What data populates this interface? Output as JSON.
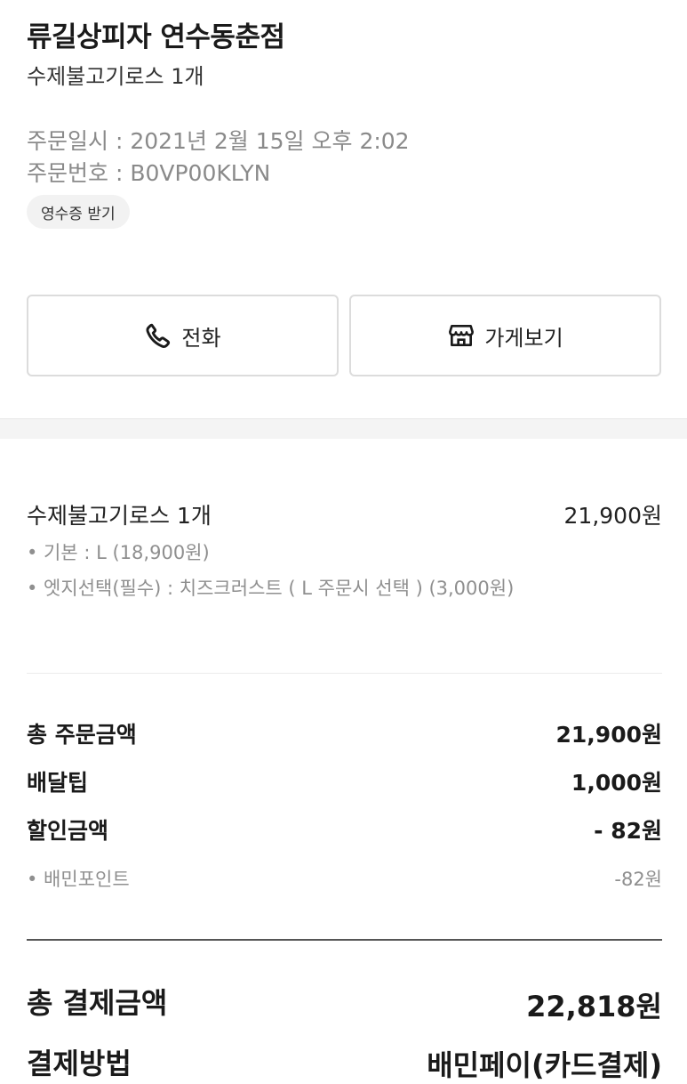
{
  "header": {
    "store_name": "류길상피자 연수동춘점",
    "order_summary": "수제불고기로스 1개",
    "order_date": "주문일시 : 2021년 2월 15일 오후 2:02",
    "order_number": "주문번호 : B0VP00KLYN",
    "receipt_label": "영수증 받기"
  },
  "actions": {
    "call_label": "전화",
    "call_icon": "phone-icon",
    "store_label": "가게보기",
    "store_icon": "store-icon"
  },
  "order_item": {
    "name": "수제불고기로스 1개",
    "price": "21,900원",
    "options": [
      "• 기본 : L (18,900원)",
      "• 엣지선택(필수) : 치즈크러스트 ( L 주문시 선택 ) (3,000원)"
    ]
  },
  "amounts": {
    "order_total_label": "총 주문금액",
    "order_total_value": "21,900원",
    "delivery_tip_label": "배달팁",
    "delivery_tip_value": "1,000원",
    "discount_label": "할인금액",
    "discount_value": "- 82원",
    "discount_detail_label": "• 배민포인트",
    "discount_detail_value": "-82원"
  },
  "payment": {
    "total_label": "총 결제금액",
    "total_value": "22,818원",
    "method_label": "결제방법",
    "method_value": "배민페이(카드결제)"
  },
  "colors": {
    "text_primary": "#1a1a1a",
    "text_secondary": "#8a8a8a",
    "border": "#dcdcdc",
    "divider_bg": "#f4f4f4"
  }
}
